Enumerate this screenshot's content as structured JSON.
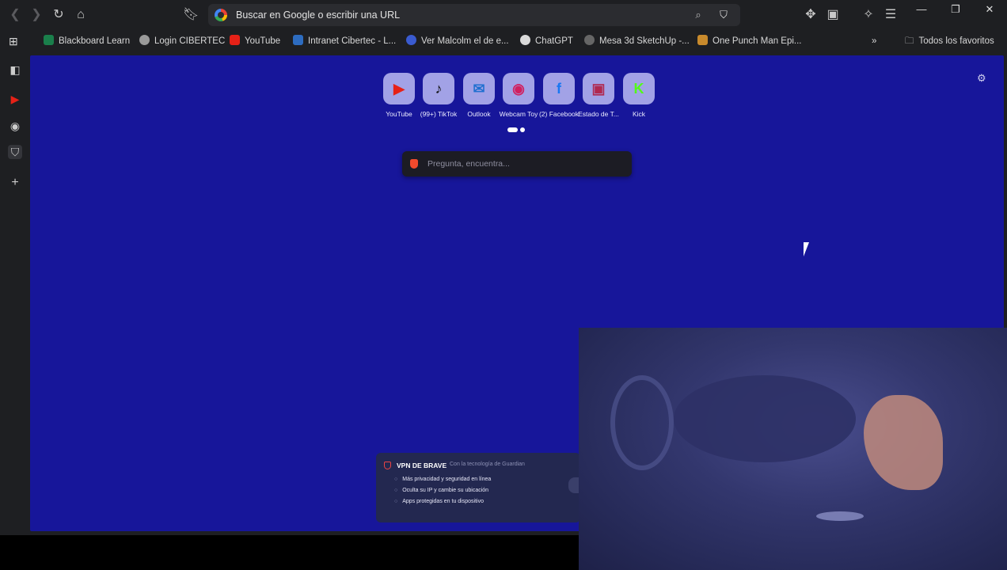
{
  "toolbar": {
    "back_icon": "arrow-left-icon",
    "forward_icon": "arrow-right-icon",
    "reload_icon": "reload-icon",
    "home_icon": "home-icon",
    "bookmark_icon": "bookmark-icon"
  },
  "address_bar": {
    "placeholder": "Buscar en Google o escribir una URL"
  },
  "bookmarks": [
    {
      "label": "Blackboard Learn",
      "color": "#1a7f4b"
    },
    {
      "label": "Login CIBERTEC",
      "color": "#9a9a9a"
    },
    {
      "label": "YouTube",
      "color": "#e62117"
    },
    {
      "label": "Intranet Cibertec - L...",
      "color": "#2d6cc0"
    },
    {
      "label": "Ver Malcolm el de e...",
      "color": "#3a5bd0"
    },
    {
      "label": "ChatGPT",
      "color": "#dadada"
    },
    {
      "label": "Mesa 3d SketchUp -...",
      "color": "#666666"
    },
    {
      "label": "One Punch Man Epi...",
      "color": "#c88a2c"
    }
  ],
  "bookmarks_more": "»",
  "all_favorites": "Todos los favoritos",
  "top_sites": [
    {
      "label": "YouTube",
      "glyph": "▶",
      "color": "#e62117"
    },
    {
      "label": "(99+) TikTok",
      "glyph": "♪",
      "color": "#111111"
    },
    {
      "label": "Outlook",
      "glyph": "✉",
      "color": "#1f6fd0"
    },
    {
      "label": "Webcam Toy",
      "glyph": "◉",
      "color": "#d02060"
    },
    {
      "label": "(2) Facebook",
      "glyph": "f",
      "color": "#1877f2"
    },
    {
      "label": "Estado de T...",
      "glyph": "▣",
      "color": "#b02850"
    },
    {
      "label": "Kick",
      "glyph": "K",
      "color": "#53fc18"
    }
  ],
  "search": {
    "placeholder": "Pregunta, encuentra..."
  },
  "vpn": {
    "title": "VPN DE BRAVE",
    "subtitle": "Con la tecnología de Guardian",
    "features": [
      "Más privacidad y seguridad en línea",
      "Oculta su IP y cambie su ubicación",
      "Apps protegidas en tu dispositivo"
    ]
  }
}
